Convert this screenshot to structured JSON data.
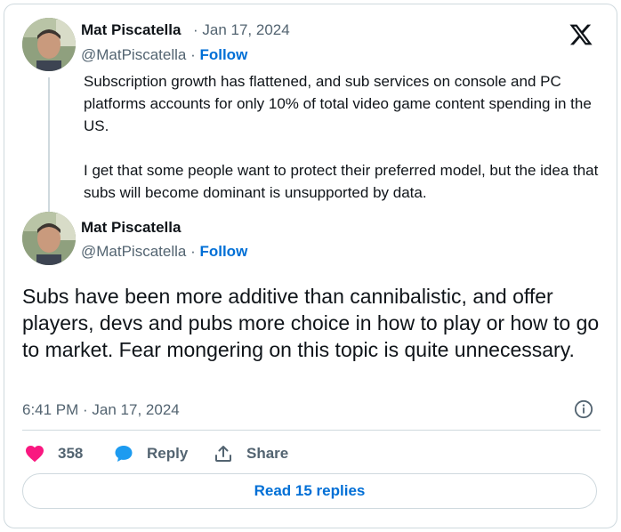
{
  "quoted_tweet": {
    "author_name": "Mat Piscatella",
    "date": "· Jan 17, 2024",
    "handle": "@MatPiscatella",
    "separator": " · ",
    "follow_label": "Follow",
    "paragraphs": [
      "Subscription growth has flattened, and sub services on console and PC platforms accounts for only 10% of total video game content spending in the US.",
      "I get that some people want to protect their preferred model, but the idea that subs will become dominant is unsupported by data."
    ]
  },
  "main_tweet": {
    "author_name": "Mat Piscatella",
    "handle": "@MatPiscatella",
    "separator": " · ",
    "follow_label": "Follow",
    "text": "Subs have been more additive than cannibalistic, and offer players, devs and pubs more choice in how to play or how to go to market. Fear mongering on this topic is quite unnecessary.",
    "timestamp": "6:41 PM · Jan 17, 2024"
  },
  "actions": {
    "like_count": "358",
    "reply_label": "Reply",
    "share_label": "Share"
  },
  "read_replies_label": "Read 15 replies",
  "colors": {
    "link": "#006fd6",
    "like": "#f91880",
    "reply_icon": "#1d9bf0",
    "secondary_text": "#536471"
  },
  "icons": [
    "x-logo-icon",
    "info-icon",
    "heart-icon",
    "reply-bubble-icon",
    "share-icon"
  ]
}
